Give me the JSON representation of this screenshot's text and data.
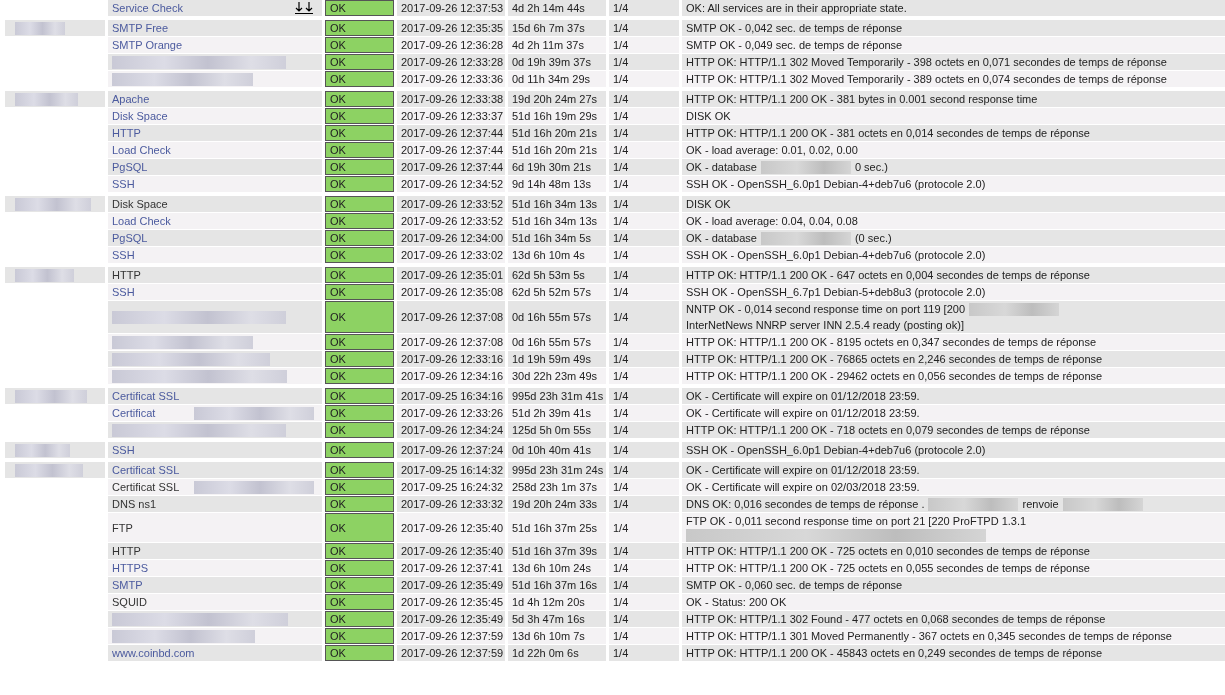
{
  "summary_row": {
    "service": "Service Check",
    "visited": false,
    "status": "OK",
    "last_check": "2017-09-26 12:37:53",
    "duration": "4d 2h 14m 44s",
    "attempt": "1/4",
    "info": [
      "OK: All services are in their appropriate state."
    ]
  },
  "groups": [
    {
      "rows": [
        {
          "service": "SMTP Free",
          "visited": false,
          "status": "OK",
          "last_check": "2017-09-26 12:35:35",
          "duration": "15d 6h 7m 37s",
          "attempt": "1/4",
          "info": [
            "SMTP OK - 0,042 sec. de temps de réponse"
          ]
        },
        {
          "service": "SMTP Orange",
          "visited": false,
          "status": "OK",
          "last_check": "2017-09-26 12:36:28",
          "duration": "4d 2h 11m 37s",
          "attempt": "1/4",
          "info": [
            "SMTP OK - 0,049 sec. de temps de réponse"
          ]
        },
        {
          "status": "OK",
          "last_check": "2017-09-26 12:33:28",
          "duration": "0d 19h 39m 37s",
          "attempt": "1/4",
          "info": [
            "HTTP OK: HTTP/1.1 302 Moved Temporarily - 398 octets en 0,071 secondes de temps de réponse"
          ]
        },
        {
          "status": "OK",
          "last_check": "2017-09-26 12:33:36",
          "duration": "0d 11h 34m 29s",
          "attempt": "1/4",
          "info": [
            "HTTP OK: HTTP/1.1 302 Moved Temporarily - 389 octets en 0,074 secondes de temps de réponse"
          ]
        }
      ]
    },
    {
      "rows": [
        {
          "service": "Apache",
          "visited": false,
          "status": "OK",
          "last_check": "2017-09-26 12:33:38",
          "duration": "19d 20h 24m 27s",
          "attempt": "1/4",
          "info": [
            "HTTP OK: HTTP/1.1 200 OK - 381 bytes in 0.001 second response time"
          ]
        },
        {
          "service": "Disk Space",
          "visited": false,
          "status": "OK",
          "last_check": "2017-09-26 12:33:37",
          "duration": "51d 16h 19m 29s",
          "attempt": "1/4",
          "info": [
            "DISK OK"
          ]
        },
        {
          "service": "HTTP",
          "visited": false,
          "status": "OK",
          "last_check": "2017-09-26 12:37:44",
          "duration": "51d 16h 20m 21s",
          "attempt": "1/4",
          "info": [
            "HTTP OK: HTTP/1.1 200 OK - 381 octets en 0,014 secondes de temps de réponse"
          ]
        },
        {
          "service": "Load Check",
          "visited": false,
          "status": "OK",
          "last_check": "2017-09-26 12:37:44",
          "duration": "51d 16h 20m 21s",
          "attempt": "1/4",
          "info": [
            "OK - load average: 0.01, 0.02, 0.00"
          ]
        },
        {
          "service": "PgSQL",
          "visited": false,
          "status": "OK",
          "last_check": "2017-09-26 12:37:44",
          "duration": "6d 19h 30m 21s",
          "attempt": "1/4",
          "info": [
            "OK - database",
            "0 sec.)"
          ]
        },
        {
          "service": "SSH",
          "visited": false,
          "status": "OK",
          "last_check": "2017-09-26 12:34:52",
          "duration": "9d 14h 48m 13s",
          "attempt": "1/4",
          "info": [
            "SSH OK - OpenSSH_6.0p1 Debian-4+deb7u6 (protocole 2.0)"
          ]
        }
      ]
    },
    {
      "rows": [
        {
          "service": "Disk Space",
          "visited": true,
          "status": "OK",
          "last_check": "2017-09-26 12:33:52",
          "duration": "51d 16h 34m 13s",
          "attempt": "1/4",
          "info": [
            "DISK OK"
          ]
        },
        {
          "service": "Load Check",
          "visited": false,
          "status": "OK",
          "last_check": "2017-09-26 12:33:52",
          "duration": "51d 16h 34m 13s",
          "attempt": "1/4",
          "info": [
            "OK - load average: 0.04, 0.04, 0.08"
          ]
        },
        {
          "service": "PgSQL",
          "visited": false,
          "status": "OK",
          "last_check": "2017-09-26 12:34:00",
          "duration": "51d 16h 34m 5s",
          "attempt": "1/4",
          "info": [
            "OK - database",
            "(0 sec.)"
          ]
        },
        {
          "service": "SSH",
          "visited": false,
          "status": "OK",
          "last_check": "2017-09-26 12:33:02",
          "duration": "13d 6h 10m 4s",
          "attempt": "1/4",
          "info": [
            "SSH OK - OpenSSH_6.0p1 Debian-4+deb7u6 (protocole 2.0)"
          ]
        }
      ]
    },
    {
      "rows": [
        {
          "service": "HTTP",
          "visited": true,
          "status": "OK",
          "last_check": "2017-09-26 12:35:01",
          "duration": "62d 5h 53m 5s",
          "attempt": "1/4",
          "info": [
            "HTTP OK: HTTP/1.1 200 OK - 647 octets en 0,004 secondes de temps de réponse"
          ]
        },
        {
          "service": "SSH",
          "visited": false,
          "status": "OK",
          "last_check": "2017-09-26 12:35:08",
          "duration": "62d 5h 52m 57s",
          "attempt": "1/4",
          "info": [
            "SSH OK - OpenSSH_6.7p1 Debian-5+deb8u3 (protocole 2.0)"
          ]
        },
        {
          "status": "OK",
          "last_check": "2017-09-26 12:37:08",
          "duration": "0d 16h 55m 57s",
          "attempt": "1/4",
          "info": [
            "NNTP OK - 0,014 second response time on port 119 [200",
            "InterNetNews NNRP server INN 2.5.4 ready (posting ok)]"
          ]
        },
        {
          "status": "OK",
          "last_check": "2017-09-26 12:37:08",
          "duration": "0d 16h 55m 57s",
          "attempt": "1/4",
          "info": [
            "HTTP OK: HTTP/1.1 200 OK - 8195 octets en 0,347 secondes de temps de réponse"
          ]
        },
        {
          "status": "OK",
          "last_check": "2017-09-26 12:33:16",
          "duration": "1d 19h 59m 49s",
          "attempt": "1/4",
          "info": [
            "HTTP OK: HTTP/1.1 200 OK - 76865 octets en 2,246 secondes de temps de réponse"
          ]
        },
        {
          "status": "OK",
          "last_check": "2017-09-26 12:34:16",
          "duration": "30d 22h 23m 49s",
          "attempt": "1/4",
          "info": [
            "HTTP OK: HTTP/1.1 200 OK - 29462 octets en 0,056 secondes de temps de réponse"
          ]
        }
      ]
    },
    {
      "rows": [
        {
          "service": "Certificat SSL",
          "visited": false,
          "status": "OK",
          "last_check": "2017-09-25 16:34:16",
          "duration": "995d 23h 31m 41s",
          "attempt": "1/4",
          "info": [
            "OK - Certificate will expire on 01/12/2018 23:59."
          ]
        },
        {
          "service": "Certificat",
          "visited": false,
          "redacted_tail": true,
          "status": "OK",
          "last_check": "2017-09-26 12:33:26",
          "duration": "51d 2h 39m 41s",
          "attempt": "1/4",
          "info": [
            "OK - Certificate will expire on 01/12/2018 23:59."
          ]
        },
        {
          "status": "OK",
          "last_check": "2017-09-26 12:34:24",
          "duration": "125d 5h 0m 55s",
          "attempt": "1/4",
          "info": [
            "HTTP OK: HTTP/1.1 200 OK - 718 octets en 0,079 secondes de temps de réponse"
          ]
        }
      ]
    },
    {
      "rows": [
        {
          "service": "SSH",
          "visited": false,
          "status": "OK",
          "last_check": "2017-09-26 12:37:24",
          "duration": "0d 10h 40m 41s",
          "attempt": "1/4",
          "info": [
            "SSH OK - OpenSSH_6.0p1 Debian-4+deb7u6 (protocole 2.0)"
          ]
        }
      ]
    },
    {
      "rows": [
        {
          "service": "Certificat SSL",
          "visited": false,
          "status": "OK",
          "last_check": "2017-09-25 16:14:32",
          "duration": "995d 23h 31m 24s",
          "attempt": "1/4",
          "info": [
            "OK - Certificate will expire on 01/12/2018 23:59."
          ]
        },
        {
          "service": "Certificat SSL",
          "visited": true,
          "redacted_tail": true,
          "status": "OK",
          "last_check": "2017-09-25 16:24:32",
          "duration": "258d 23h 1m 37s",
          "attempt": "1/4",
          "info": [
            "OK - Certificate will expire on 02/03/2018 23:59."
          ]
        },
        {
          "service": "DNS ns1",
          "visited": true,
          "status": "OK",
          "last_check": "2017-09-26 12:33:32",
          "duration": "19d 20h 24m 33s",
          "attempt": "1/4",
          "info": [
            "DNS OK: 0,016 secondes de temps de réponse .",
            "renvoie"
          ],
          "redacted_end": true
        },
        {
          "service": "FTP",
          "visited": true,
          "status": "OK",
          "last_check": "2017-09-26 12:35:40",
          "duration": "51d 16h 37m 25s",
          "attempt": "1/4",
          "info": [
            "FTP OK - 0,011 second response time on port 21 [220 ProFTPD 1.3.1"
          ],
          "redacted_end": true
        },
        {
          "service": "HTTP",
          "visited": true,
          "status": "OK",
          "last_check": "2017-09-26 12:35:40",
          "duration": "51d 16h 37m 39s",
          "attempt": "1/4",
          "info": [
            "HTTP OK: HTTP/1.1 200 OK - 725 octets en 0,010 secondes de temps de réponse"
          ]
        },
        {
          "service": "HTTPS",
          "visited": false,
          "status": "OK",
          "last_check": "2017-09-26 12:37:41",
          "duration": "13d 6h 10m 24s",
          "attempt": "1/4",
          "info": [
            "HTTP OK: HTTP/1.1 200 OK - 725 octets en 0,055 secondes de temps de réponse"
          ]
        },
        {
          "service": "SMTP",
          "visited": false,
          "status": "OK",
          "last_check": "2017-09-26 12:35:49",
          "duration": "51d 16h 37m 16s",
          "attempt": "1/4",
          "info": [
            "SMTP OK - 0,060 sec. de temps de réponse"
          ]
        },
        {
          "service": "SQUID",
          "visited": true,
          "status": "OK",
          "last_check": "2017-09-26 12:35:45",
          "duration": "1d 4h 12m 20s",
          "attempt": "1/4",
          "info": [
            "OK - Status: 200 OK"
          ]
        },
        {
          "status": "OK",
          "last_check": "2017-09-26 12:35:49",
          "duration": "5d 3h 47m 16s",
          "attempt": "1/4",
          "info": [
            "HTTP OK: HTTP/1.1 302 Found - 477 octets en 0,068 secondes de temps de réponse"
          ]
        },
        {
          "status": "OK",
          "last_check": "2017-09-26 12:37:59",
          "duration": "13d 6h 10m 7s",
          "attempt": "1/4",
          "info": [
            "HTTP OK: HTTP/1.1 301 Moved Permanently - 367 octets en 0,345 secondes de temps de réponse"
          ]
        },
        {
          "service": "www.coinbd.com",
          "visited": false,
          "status": "OK",
          "last_check": "2017-09-26 12:37:59",
          "duration": "1d 22h 0m 6s",
          "attempt": "1/4",
          "info": [
            "HTTP OK: HTTP/1.1 200 OK - 45843 octets en 0,249 secondes de temps de réponse"
          ]
        }
      ]
    }
  ]
}
